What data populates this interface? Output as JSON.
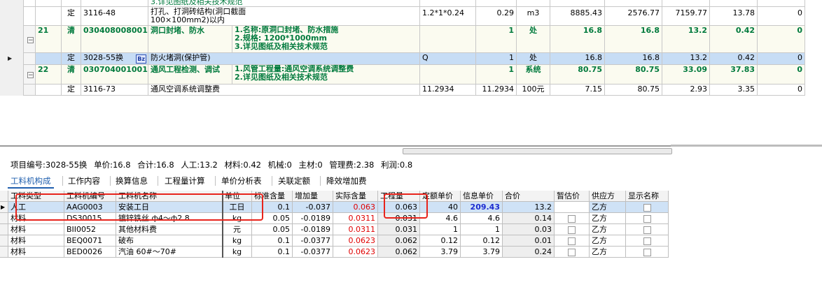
{
  "top_rows": [
    {
      "type": "定",
      "code": "3116-48",
      "name": "打孔、打洞砖结构(洞口截面100×100mm2)以内",
      "expr": "1.2*1*0.24",
      "qty": "0.29",
      "unit": "m3",
      "price": "8885.43",
      "total": "2576.77",
      "labor": "7159.77",
      "material": "13.78",
      "last": "0",
      "note": "3.详见图纸及相关技术规范"
    },
    {
      "no": "21",
      "type": "清",
      "code": "030408008001",
      "name": "洞口封堵、防水",
      "desc1": "1.名称:原洞口封堵、防水措施",
      "desc2": "2.规格: 1200*1000mm",
      "desc3": "3.详见图纸及相关技术规范",
      "qty": "1",
      "unit": "处",
      "price": "16.8",
      "total": "16.8",
      "labor": "13.2",
      "material": "0.42",
      "last": "0"
    },
    {
      "type": "定",
      "code": "3028-55换",
      "badge": "Bz",
      "name": "防火堵洞(保护管)",
      "expr": "Q",
      "qty": "1",
      "unit": "处",
      "price": "16.8",
      "total": "16.8",
      "labor": "13.2",
      "material": "0.42",
      "last": "0"
    },
    {
      "no": "22",
      "type": "清",
      "code": "030704001001",
      "name": "通风工程检测、调试",
      "desc1": "1.风管工程量:通风空调系统调整费",
      "desc2": "2.详见图纸及相关技术规范",
      "qty": "1",
      "unit": "系统",
      "price": "80.75",
      "total": "80.75",
      "labor": "33.09",
      "material": "37.83",
      "last": "0"
    },
    {
      "type": "定",
      "code": "3116-73",
      "name": "通风空调系统调整费",
      "expr": "11.2934",
      "qty": "11.2934",
      "unit": "100元",
      "price": "7.15",
      "total": "80.75",
      "labor": "2.93",
      "material": "3.35",
      "last": "0"
    }
  ],
  "info": {
    "code": "项目编号:3028-55换",
    "price": "单价:16.8",
    "total": "合计:16.8",
    "labor": "人工:13.2",
    "material": "材料:0.42",
    "machine": "机械:0",
    "main": "主材:0",
    "manage": "管理费:2.38",
    "profit": "利润:0.8"
  },
  "tabs": [
    "工料机构成",
    "工作内容",
    "换算信息",
    "工程量计算",
    "单价分析表",
    "关联定额",
    "降效增加费"
  ],
  "lower_headers": [
    "工料类型",
    "工料机编号",
    "工料机名称",
    "单位",
    "标准含量",
    "增加量",
    "实际含量",
    "工程量",
    "定额单价",
    "信息单价",
    "合价",
    "暂估价",
    "供应方",
    "显示名称"
  ],
  "lower_rows": [
    [
      "人工",
      "AAG0003",
      "安装工日",
      "工日",
      "0.1",
      "-0.037",
      "0.063",
      "0.063",
      "40",
      "209.43",
      "13.2",
      "",
      "乙方",
      ""
    ],
    [
      "材料",
      "DS30015",
      "镀锌铁丝 ф4～ф2.8",
      "kg",
      "0.05",
      "-0.0189",
      "0.0311",
      "0.031",
      "4.6",
      "4.6",
      "0.14",
      "",
      "乙方",
      ""
    ],
    [
      "材料",
      "BII0052",
      "其他材料费",
      "元",
      "0.05",
      "-0.0189",
      "0.0311",
      "0.031",
      "1",
      "1",
      "0.03",
      "",
      "乙方",
      ""
    ],
    [
      "材料",
      "BEQ0071",
      "破布",
      "kg",
      "0.1",
      "-0.0377",
      "0.0623",
      "0.062",
      "0.12",
      "0.12",
      "0.01",
      "",
      "乙方",
      ""
    ],
    [
      "材料",
      "BED0026",
      "汽油 60#～70#",
      "kg",
      "0.1",
      "-0.0377",
      "0.0623",
      "0.062",
      "3.79",
      "3.79",
      "0.24",
      "",
      "乙方",
      ""
    ]
  ],
  "colors": {
    "selection": "#c7ddf5",
    "accent_green": "#007a3d",
    "red": "#e00000",
    "blue": "#1b2bd0",
    "annotation": "#e8241c"
  }
}
